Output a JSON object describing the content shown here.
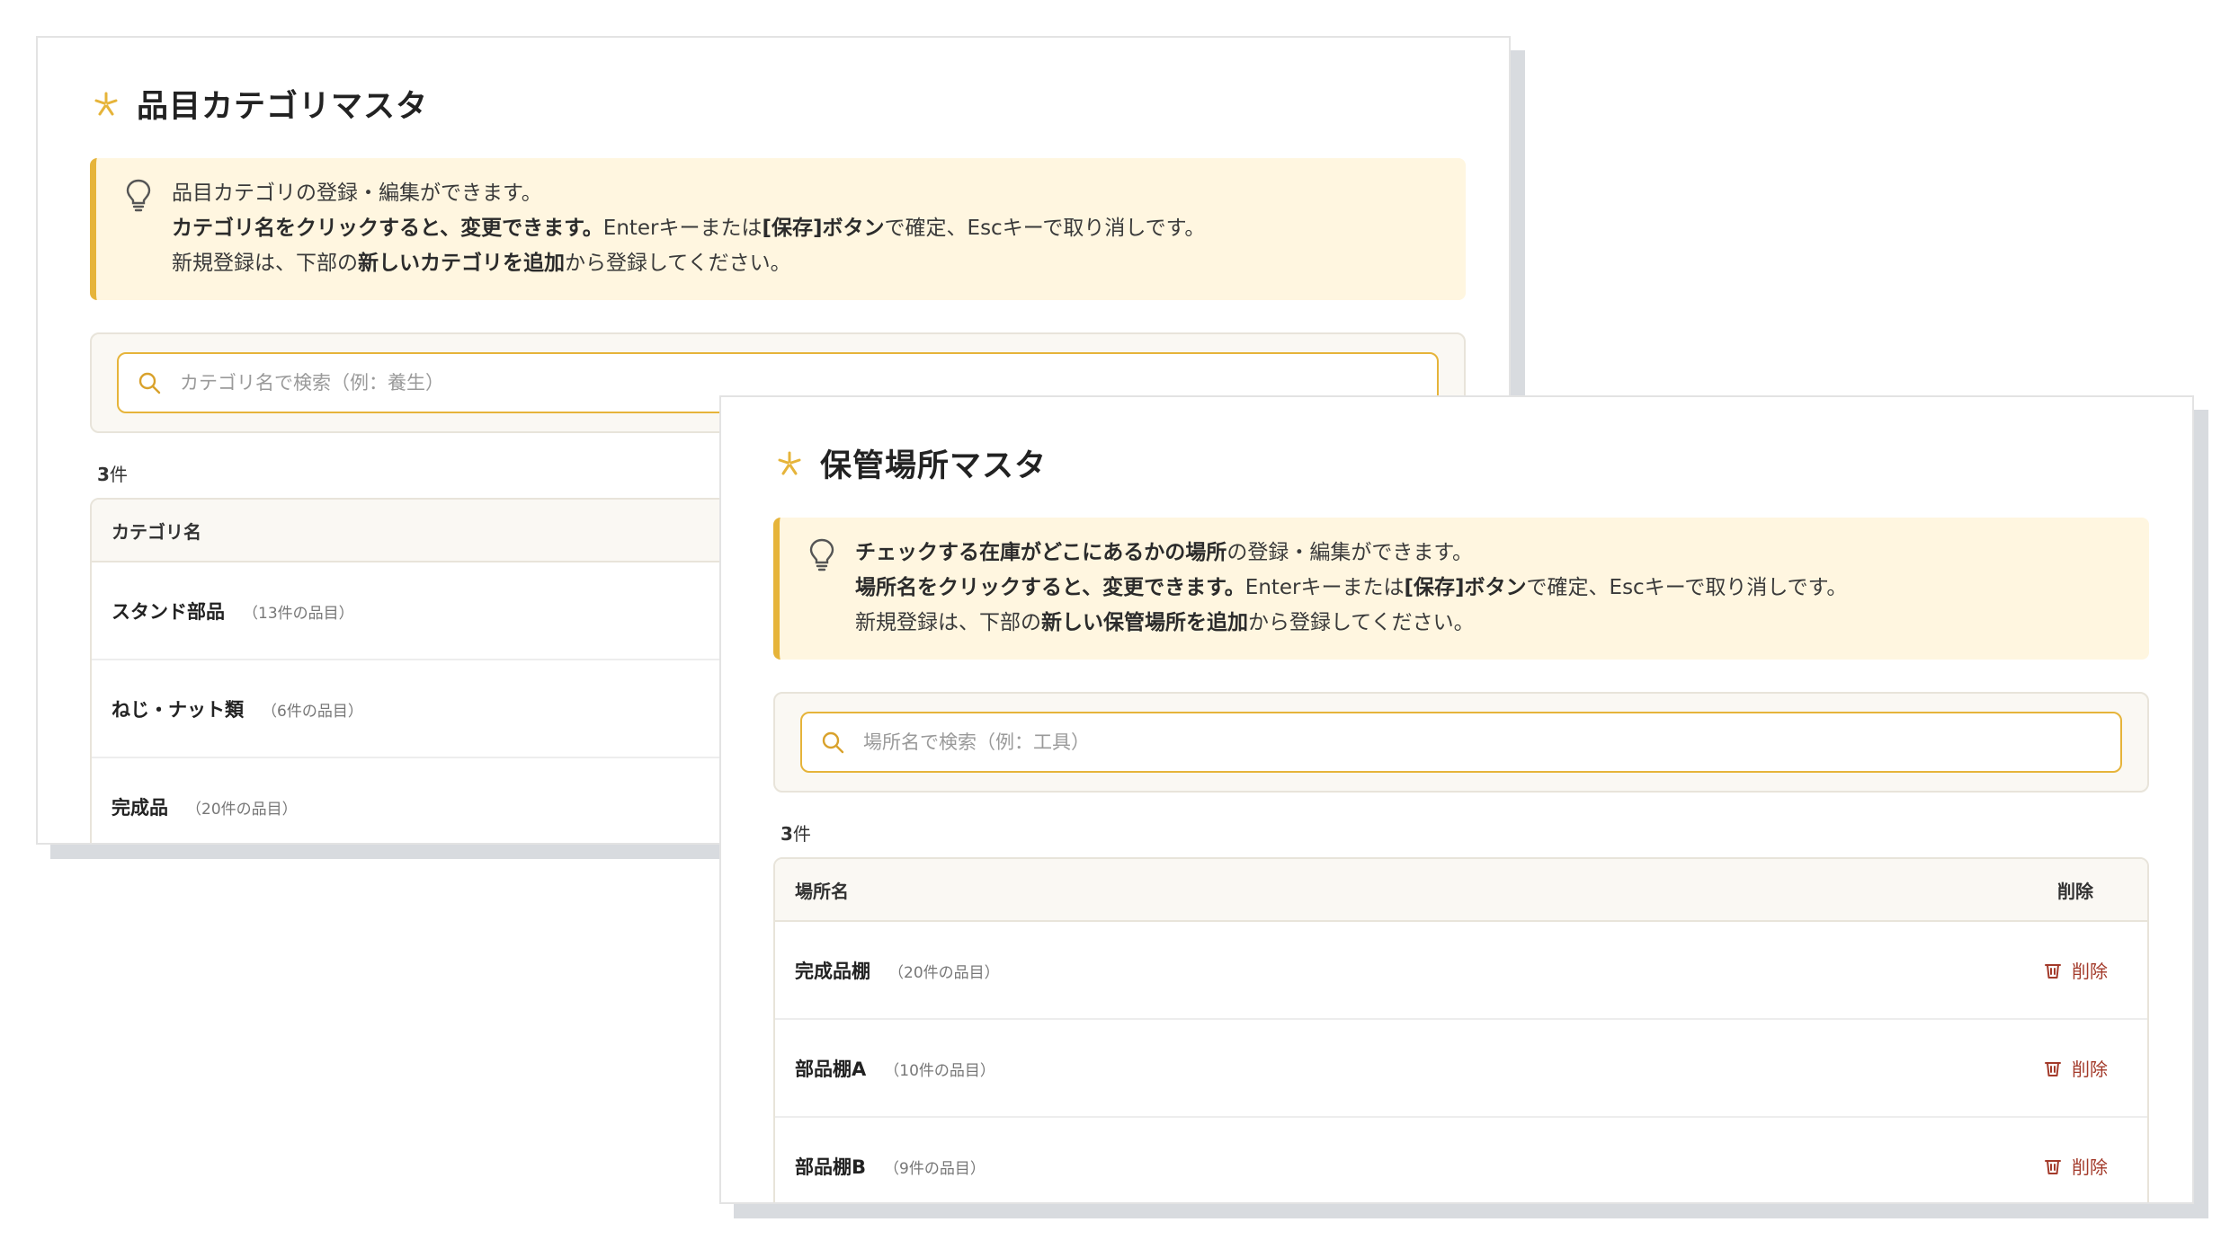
{
  "category_master": {
    "title": "品目カテゴリマスタ",
    "info": {
      "line1": "品目カテゴリの登録・編集ができます。",
      "line2_bold1": "カテゴリ名をクリックすると、変更できます。",
      "line2_text1": "Enterキーまたは",
      "line2_bold2": "[保存]ボタン",
      "line2_text2": "で確定、Escキーで取り消しです。",
      "line3_text1": "新規登録は、下部の",
      "line3_bold": "新しいカテゴリを追加",
      "line3_text2": "から登録してください。"
    },
    "search": {
      "placeholder": "カテゴリ名で検索（例：養生）"
    },
    "count": "3",
    "count_unit": "件",
    "table": {
      "header_name": "カテゴリ名",
      "rows": [
        {
          "name": "スタンド部品",
          "sub": "（13件の品目）"
        },
        {
          "name": "ねじ・ナット類",
          "sub": "（6件の品目）"
        },
        {
          "name": "完成品",
          "sub": "（20件の品目）"
        }
      ]
    }
  },
  "location_master": {
    "title": "保管場所マスタ",
    "info": {
      "line1_bold": "チェックする在庫がどこにあるかの場所",
      "line1_text": "の登録・編集ができます。",
      "line2_bold1": "場所名をクリックすると、変更できます。",
      "line2_text1": "Enterキーまたは",
      "line2_bold2": "[保存]ボタン",
      "line2_text2": "で確定、Escキーで取り消しです。",
      "line3_text1": "新規登録は、下部の",
      "line3_bold": "新しい保管場所を追加",
      "line3_text2": "から登録してください。"
    },
    "search": {
      "placeholder": "場所名で検索（例：工具）"
    },
    "count": "3",
    "count_unit": "件",
    "table": {
      "header_name": "場所名",
      "header_delete": "削除",
      "rows": [
        {
          "name": "完成品棚",
          "sub": "（20件の品目）",
          "delete_label": "削除"
        },
        {
          "name": "部品棚A",
          "sub": "（10件の品目）",
          "delete_label": "削除"
        },
        {
          "name": "部品棚B",
          "sub": "（9件の品目）",
          "delete_label": "削除"
        }
      ]
    }
  },
  "colors": {
    "accent": "#e6b43a",
    "info_bg": "#fff6e0",
    "delete": "#a33a2a"
  },
  "icons": {
    "title": "flower-icon",
    "info": "lightbulb-icon",
    "search": "search-icon",
    "delete": "trash-icon"
  }
}
